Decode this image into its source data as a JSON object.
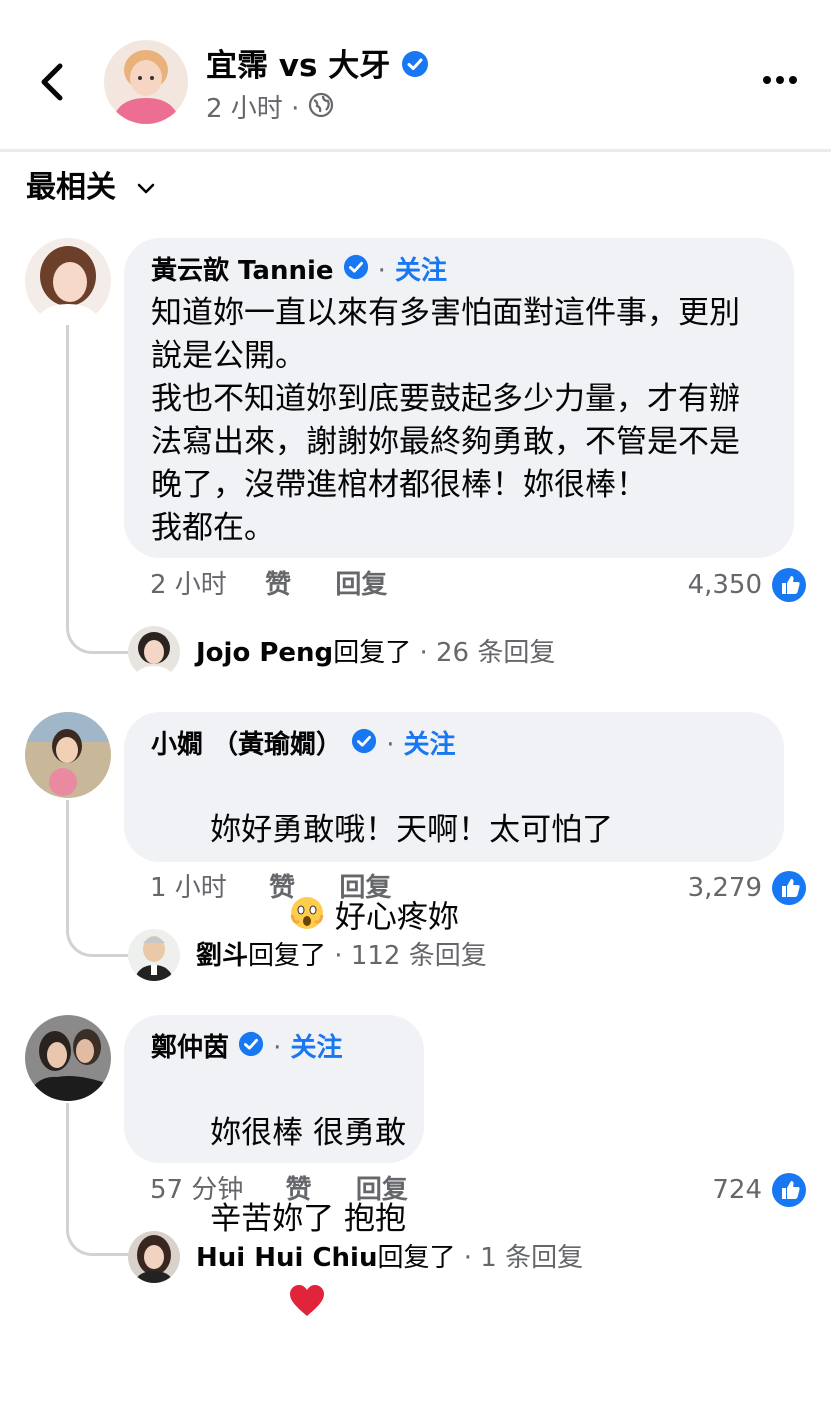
{
  "header": {
    "page_name": "宜霈 vs 大牙",
    "time": "2 小时",
    "separator": "·",
    "icons": [
      "back-arrow-icon",
      "verified-badge-icon",
      "globe-icon",
      "more-options-icon"
    ]
  },
  "sort": {
    "label": "最相关"
  },
  "comments": [
    {
      "name": "黃云歆 Tannie",
      "follow": "关注",
      "text": "知道妳一直以來有多害怕面對這件事，更別\n說是公開。\n我也不知道妳到底要鼓起多少力量，才有辦\n法寫出來，謝謝妳最終夠勇敢，不管是不是\n晚了，沒帶進棺材都很棒！妳很棒！\n我都在。",
      "time": "2 小时",
      "like_label": "赞",
      "reply_label": "回复",
      "likes": "4,350",
      "reply_preview": {
        "name": "Jojo Peng",
        "action": "回复了",
        "count": "26 条回复"
      }
    },
    {
      "name": "小嫺 （黃瑜嫺）",
      "follow": "关注",
      "text": "妳好勇敢哦！天啊！太可怕了",
      "text_tail": " 好心疼妳",
      "time": "1 小时",
      "like_label": "赞",
      "reply_label": "回复",
      "likes": "3,279",
      "reply_preview": {
        "name": "劉斗",
        "action": "回复了",
        "count": "112 条回复"
      }
    },
    {
      "name": "鄭仲茵",
      "follow": "关注",
      "text_line1": "妳很棒 很勇敢",
      "text_line2": "辛苦妳了 抱抱",
      "time": "57 分钟",
      "like_label": "赞",
      "reply_label": "回复",
      "likes": "724",
      "reply_preview": {
        "name": "Hui Hui Chiu",
        "action": "回复了",
        "count": "1 条回复"
      }
    }
  ],
  "colors": {
    "accent": "#1877f2",
    "bubble": "#f0f2f5",
    "muted": "#65676b",
    "thread": "#d0d2d6"
  }
}
